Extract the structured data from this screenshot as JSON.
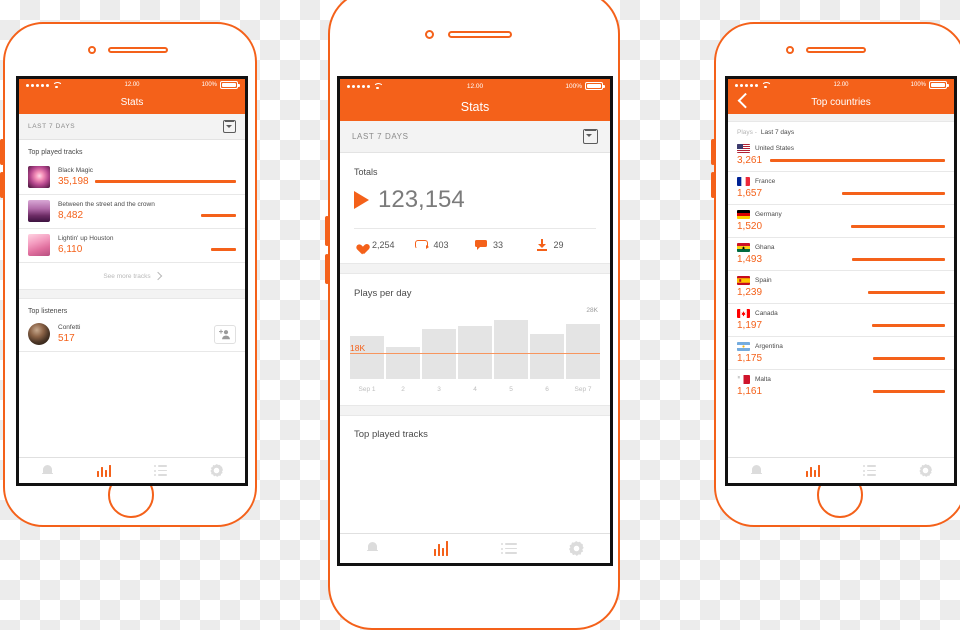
{
  "brand": {
    "accent": "#f4611a",
    "muted_gray": "#8a8a8a",
    "bar_gray": "#e4e4e4"
  },
  "status_bar": {
    "time": "12.00",
    "battery": "100%",
    "signal_icon": "signal-dots-icon",
    "wifi_icon": "wifi-icon",
    "battery_icon": "battery-icon"
  },
  "phone1": {
    "nav": {
      "title": "Stats"
    },
    "period": {
      "label": "LAST 7 DAYS",
      "icon": "calendar-icon"
    },
    "top_tracks": {
      "title": "Top played tracks",
      "rows": [
        {
          "name": "Black Magic",
          "value": "35,198",
          "bar_pct": 100
        },
        {
          "name": "Between the street and the crown",
          "value": "8,482",
          "bar_pct": 24
        },
        {
          "name": "Lightin' up Houston",
          "value": "6,110",
          "bar_pct": 17
        }
      ],
      "see_more": "See more tracks"
    },
    "top_listeners": {
      "title": "Top listeners",
      "rows": [
        {
          "name": "Confetti",
          "value": "517",
          "action_icon": "add-user-icon"
        }
      ]
    },
    "tabs": [
      {
        "name": "notifications",
        "icon": "bell-icon",
        "active": false
      },
      {
        "name": "stats",
        "icon": "bar-chart-icon",
        "active": true
      },
      {
        "name": "list",
        "icon": "list-icon",
        "active": false
      },
      {
        "name": "settings",
        "icon": "gear-icon",
        "active": false
      }
    ]
  },
  "phone2": {
    "nav": {
      "title": "Stats"
    },
    "period": {
      "label": "LAST 7 DAYS",
      "icon": "calendar-icon"
    },
    "totals": {
      "title": "Totals",
      "plays": "123,154",
      "play_icon": "play-triangle-icon",
      "metrics": [
        {
          "icon": "heart-icon",
          "value": "2,254"
        },
        {
          "icon": "repost-icon",
          "value": "403"
        },
        {
          "icon": "comment-icon",
          "value": "33"
        },
        {
          "icon": "download-icon",
          "value": "29"
        }
      ]
    },
    "plays_per_day_title": "Plays per day",
    "footer_section_title": "Top played tracks",
    "tabs": [
      {
        "name": "notifications",
        "icon": "bell-icon",
        "active": false
      },
      {
        "name": "stats",
        "icon": "bar-chart-icon",
        "active": true
      },
      {
        "name": "list",
        "icon": "list-icon",
        "active": false
      },
      {
        "name": "settings",
        "icon": "gear-icon",
        "active": false
      }
    ]
  },
  "phone3": {
    "nav": {
      "title": "Top countries",
      "back_icon": "back-chevron-icon"
    },
    "subheader": {
      "prefix": "Plays -",
      "value": "Last 7 days"
    },
    "rows": [
      {
        "country": "United States",
        "value": "3,261",
        "bar_pct": 100,
        "flag": "us"
      },
      {
        "country": "France",
        "value": "1,657",
        "bar_pct": 59,
        "flag": "fr"
      },
      {
        "country": "Germany",
        "value": "1,520",
        "bar_pct": 54,
        "flag": "de"
      },
      {
        "country": "Ghana",
        "value": "1,493",
        "bar_pct": 53,
        "flag": "gh"
      },
      {
        "country": "Spain",
        "value": "1,239",
        "bar_pct": 44,
        "flag": "es"
      },
      {
        "country": "Canada",
        "value": "1,197",
        "bar_pct": 42,
        "flag": "ca"
      },
      {
        "country": "Argentina",
        "value": "1,175",
        "bar_pct": 41,
        "flag": "ar"
      },
      {
        "country": "Malta",
        "value": "1,161",
        "bar_pct": 41,
        "flag": "mt"
      }
    ],
    "tabs": [
      {
        "name": "notifications",
        "icon": "bell-icon",
        "active": false
      },
      {
        "name": "stats",
        "icon": "bar-chart-icon",
        "active": true
      },
      {
        "name": "list",
        "icon": "list-icon",
        "active": false
      },
      {
        "name": "settings",
        "icon": "gear-icon",
        "active": false
      }
    ]
  },
  "chart_data": {
    "type": "bar",
    "title": "Plays per day",
    "categories": [
      "Sep 1",
      "2",
      "3",
      "4",
      "5",
      "6",
      "Sep 7"
    ],
    "values": [
      19500,
      14500,
      22500,
      24000,
      26500,
      20500,
      25000
    ],
    "xlabel": "",
    "ylabel": "",
    "ylim": [
      0,
      28000
    ],
    "grid": false,
    "top_tick_label": "28K",
    "average_line": {
      "value": 18000,
      "label": "18K",
      "color": "#f7955e"
    },
    "bar_color": "#e4e4e4",
    "legend": "none"
  }
}
